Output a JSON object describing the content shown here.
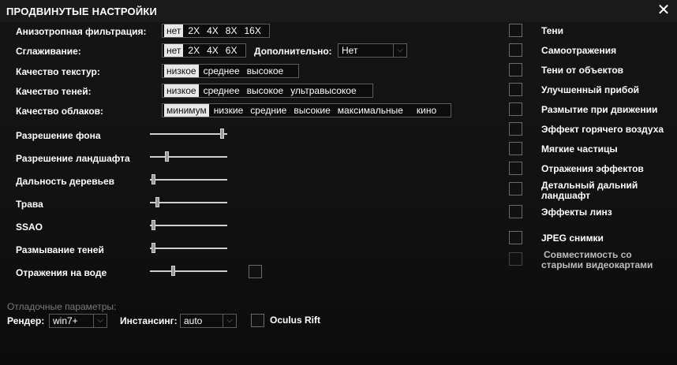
{
  "window": {
    "title": "ПРОДВИНУТЫЕ НАСТРОЙКИ",
    "close_glyph": "✕"
  },
  "anisotropic": {
    "label": "Анизотропная фильтрация:",
    "options": [
      "нет",
      "2X",
      "4X",
      "8X",
      "16X"
    ],
    "selected": "нет"
  },
  "antialias": {
    "label": "Сглаживание:",
    "options": [
      "нет",
      "2X",
      "4X",
      "6X"
    ],
    "selected": "нет",
    "extra_label": "Дополнительно:",
    "extra_value": "Нет"
  },
  "texture_quality": {
    "label": "Качество текстур:",
    "options": [
      "низкое",
      "среднее",
      "высокое"
    ],
    "selected": "низкое"
  },
  "shadow_quality": {
    "label": "Качество теней:",
    "options": [
      "низкое",
      "среднее",
      "высокое",
      "ультравысокое"
    ],
    "selected": "низкое"
  },
  "cloud_quality": {
    "label": "Качество облаков:",
    "options": [
      "минимум",
      "низкие",
      "средние",
      "высокие",
      "максимальные",
      "кино"
    ],
    "selected": "минимум"
  },
  "sliders": [
    {
      "label": "Разрешение фона",
      "level": 0.96
    },
    {
      "label": "Разрешение ландшафта",
      "level": 0.2
    },
    {
      "label": "Дальность деревьев",
      "level": 0.02
    },
    {
      "label": "Трава",
      "level": 0.08
    },
    {
      "label": "SSAO",
      "level": 0.02
    },
    {
      "label": "Размывание теней",
      "level": 0.02
    },
    {
      "label": "Отражения на воде",
      "level": 0.29
    }
  ],
  "water_checkbox": false,
  "right_options": [
    {
      "label": "Тени",
      "checked": false
    },
    {
      "label": "Самоотражения",
      "checked": false
    },
    {
      "label": "Тени от объектов",
      "checked": false
    },
    {
      "label": "Улучшенный прибой",
      "checked": false
    },
    {
      "label": "Размытие при движении",
      "checked": false
    },
    {
      "label": "Эффект горячего воздуха",
      "checked": false
    },
    {
      "label": "Мягкие частицы",
      "checked": false
    },
    {
      "label": "Отражения эффектов",
      "checked": false
    },
    {
      "label": "Детальный дальний ландшафт",
      "checked": false
    },
    {
      "label": "Эффекты линз",
      "checked": false
    },
    {
      "label": "JPEG снимки",
      "checked": false
    },
    {
      "label": "Совместимость со старыми видеокартами",
      "checked": false,
      "disabled": true
    }
  ],
  "debug": {
    "title": "Отладочные параметры:",
    "renderer_label": "Рендер:",
    "renderer_value": "win7+",
    "instancing_label": "Инстансинг:",
    "instancing_value": "auto",
    "oculus_label": "Oculus Rift",
    "oculus_checked": false
  },
  "colors": {
    "accent_selected": "#e8e8e8",
    "border": "#5c5c5c",
    "background": "#111111"
  }
}
